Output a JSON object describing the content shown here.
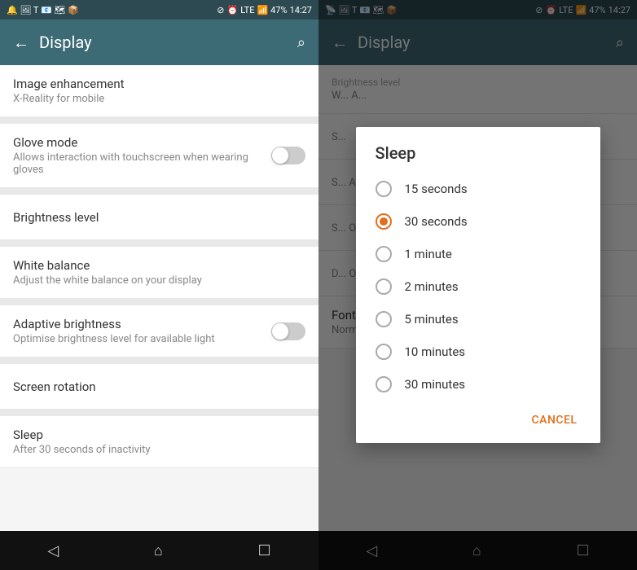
{
  "left_panel": {
    "status_bar": {
      "time": "14:27",
      "battery": "47%"
    },
    "toolbar": {
      "title": "Display",
      "back_label": "←",
      "search_label": "🔍"
    },
    "settings": [
      {
        "id": "image-enhancement",
        "title": "Image enhancement",
        "subtitle": "X-Reality for mobile",
        "has_toggle": false
      },
      {
        "id": "glove-mode",
        "title": "Glove mode",
        "subtitle": "Allows interaction with touchscreen when wearing gloves",
        "has_toggle": true,
        "toggle_on": false
      },
      {
        "id": "brightness-level",
        "title": "Brightness level",
        "subtitle": "",
        "has_toggle": false
      },
      {
        "id": "white-balance",
        "title": "White balance",
        "subtitle": "Adjust the white balance on your display",
        "has_toggle": false
      },
      {
        "id": "adaptive-brightness",
        "title": "Adaptive brightness",
        "subtitle": "Optimise brightness level for available light",
        "has_toggle": true,
        "toggle_on": false
      },
      {
        "id": "screen-rotation",
        "title": "Screen rotation",
        "subtitle": "",
        "has_toggle": false
      },
      {
        "id": "sleep",
        "title": "Sleep",
        "subtitle": "After 30 seconds of inactivity",
        "has_toggle": false
      }
    ],
    "nav": {
      "back": "◁",
      "home": "⌂",
      "square": "☐"
    }
  },
  "right_panel": {
    "status_bar": {
      "time": "14:27",
      "battery": "47%"
    },
    "toolbar": {
      "title": "Display",
      "back_label": "←",
      "search_label": "🔍"
    },
    "background_items": [
      {
        "label": "Brightness level",
        "detail": "W... A..."
      },
      {
        "label": "S..."
      },
      {
        "label": "S... A..."
      },
      {
        "label": "S... O..."
      },
      {
        "label": "D... O..."
      },
      {
        "label": "Font size",
        "detail": "Normal"
      }
    ],
    "dialog": {
      "title": "Sleep",
      "options": [
        {
          "label": "15 seconds",
          "selected": false
        },
        {
          "label": "30 seconds",
          "selected": true
        },
        {
          "label": "1 minute",
          "selected": false
        },
        {
          "label": "2 minutes",
          "selected": false
        },
        {
          "label": "5 minutes",
          "selected": false
        },
        {
          "label": "10 minutes",
          "selected": false
        },
        {
          "label": "30 minutes",
          "selected": false
        }
      ],
      "cancel_label": "CANCEL"
    },
    "nav": {
      "back": "◁",
      "home": "⌂",
      "square": "☐"
    }
  }
}
